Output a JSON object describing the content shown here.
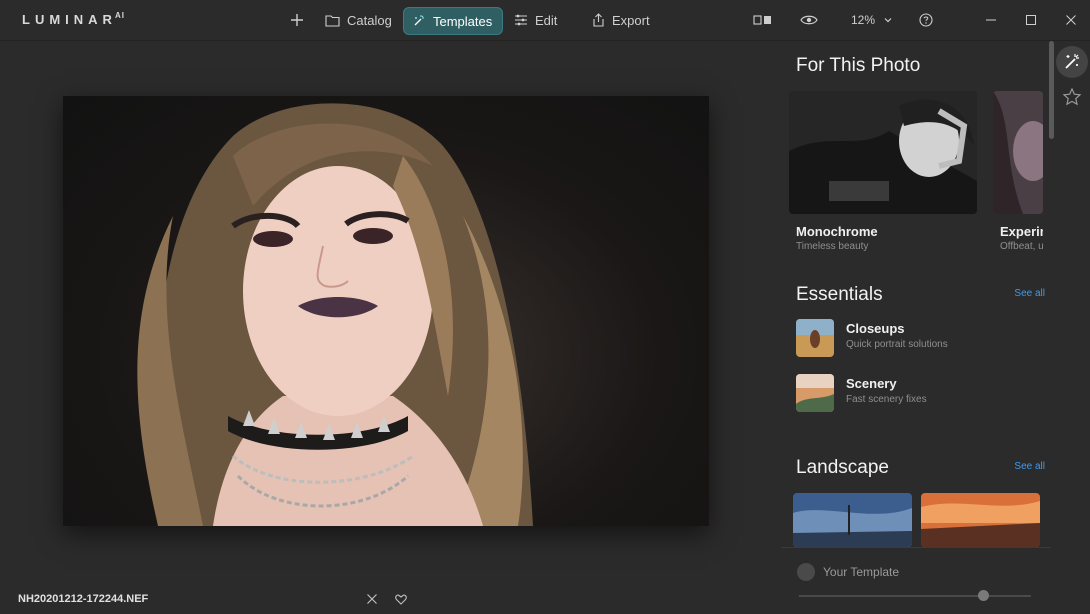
{
  "app": {
    "logo": "LUMINAR",
    "logo_suffix": "AI"
  },
  "nav": {
    "catalog": "Catalog",
    "templates": "Templates",
    "edit": "Edit",
    "export": "Export",
    "zoom": "12%"
  },
  "file": {
    "name": "NH20201212-172244.NEF"
  },
  "panel": {
    "for_this_photo": "For This Photo",
    "featured": [
      {
        "name": "Monochrome",
        "desc": "Timeless beauty"
      },
      {
        "name": "Experim",
        "desc": "Offbeat, u"
      }
    ],
    "essentials": {
      "title": "Essentials",
      "see_all": "See all",
      "items": [
        {
          "name": "Closeups",
          "desc": "Quick portrait solutions"
        },
        {
          "name": "Scenery",
          "desc": "Fast scenery fixes"
        }
      ]
    },
    "landscape": {
      "title": "Landscape",
      "see_all": "See all"
    },
    "your_template": "Your Template"
  },
  "colors": {
    "accent": "#2f5f63",
    "link": "#3d9cf0",
    "background": "#2b2b2b"
  }
}
